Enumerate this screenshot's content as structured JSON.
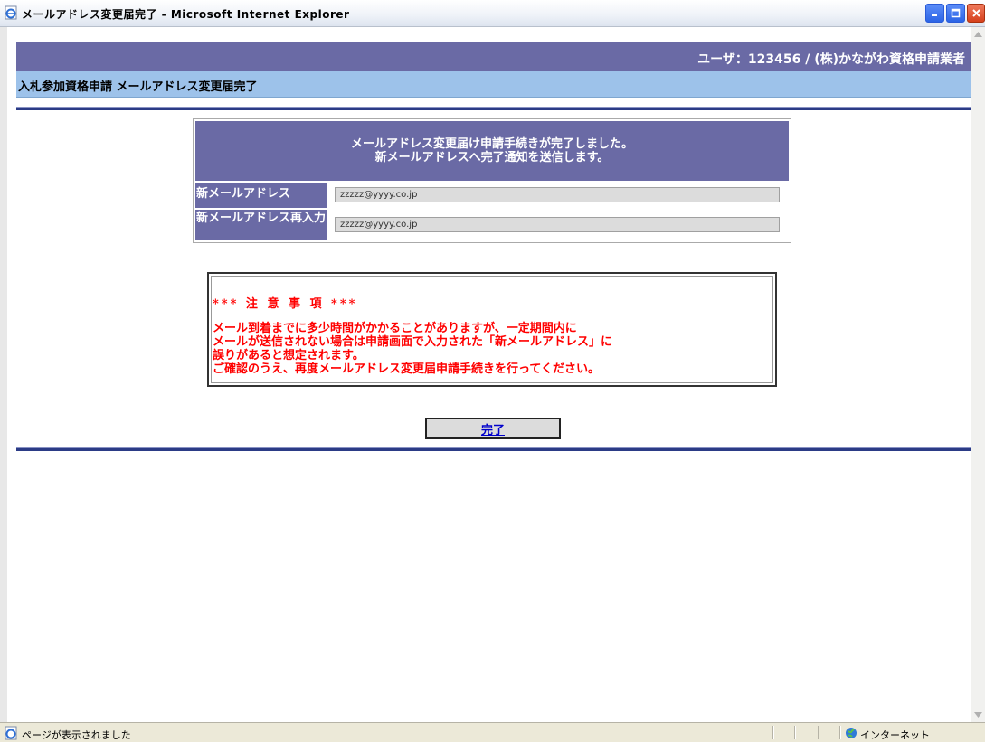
{
  "window": {
    "title": "メールアドレス変更届完了 - Microsoft Internet Explorer"
  },
  "header": {
    "user": "ユーザ：123456 / (株)かながわ資格申請業者",
    "page_title": "入札参加資格申請 メールアドレス変更届完了"
  },
  "form": {
    "message_line1": "メールアドレス変更届け申請手続きが完了しました。",
    "message_line2": "新メールアドレスへ完了通知を送信します。",
    "new_email_label": "新メールアドレス",
    "new_email_value": "zzzzz@yyyy.co.jp",
    "confirm_email_label": "新メールアドレス再入力",
    "confirm_email_value": "zzzzz@yyyy.co.jp"
  },
  "notice": {
    "title": "*** 注 意 事 項 ***",
    "lines": [
      "メール到着までに多少時間がかかることがありますが、一定期間内に",
      "メールが送信されない場合は申請画面で入力された「新メールアドレス」に",
      "誤りがあると想定されます。",
      "ご確認のうえ、再度メールアドレス変更届申請手続きを行ってください。"
    ]
  },
  "actions": {
    "done_label": "完了"
  },
  "statusbar": {
    "status": "ページが表示されました",
    "zone": "インターネット"
  },
  "colors": {
    "header_bg": "#6a6aa5",
    "title_bar_bg": "#9dc2ea",
    "rule": "#2b3b86",
    "notice_text": "#ff0000",
    "link": "#0000cc"
  },
  "icons": {
    "title": "ie-page-icon",
    "status": "ie-page-icon",
    "zone": "globe-icon"
  }
}
